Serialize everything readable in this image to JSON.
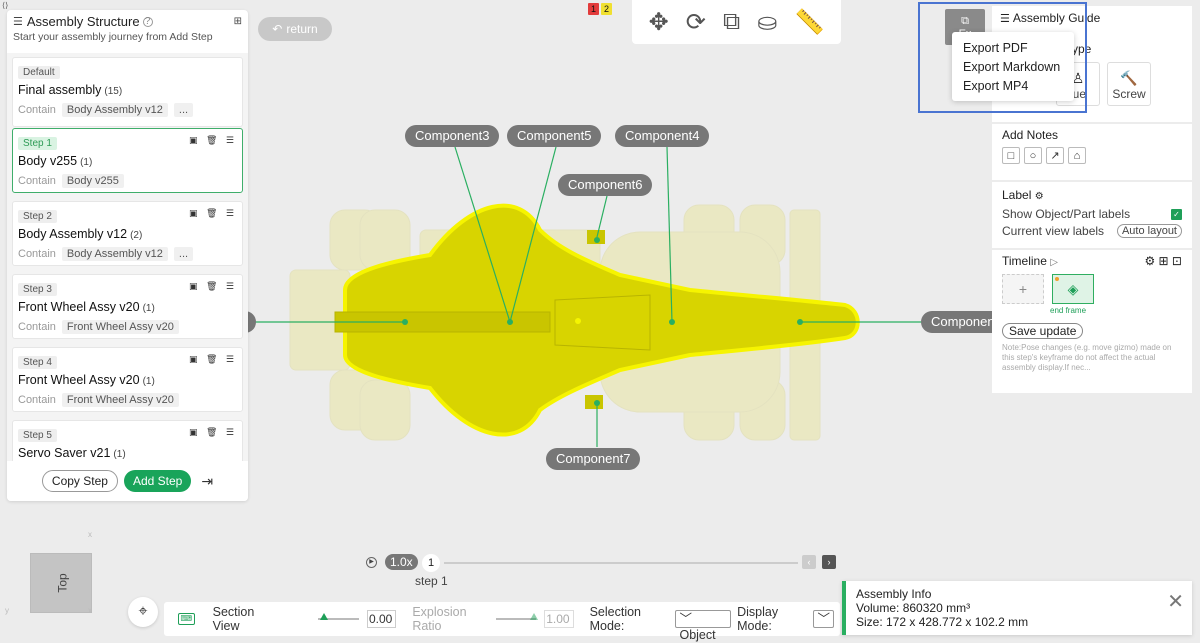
{
  "corner_glyph": "⟨⟩",
  "left_panel": {
    "title": "Assembly Structure",
    "subtitle": "Start your assembly journey from Add Step",
    "help_glyph": "?",
    "list_glyph": "☰",
    "grid_glyph": "⊞",
    "steps": [
      {
        "tag": "Default",
        "name": "Final assembly",
        "count": "(15)",
        "contain_label": "Contain",
        "chips": [
          "Body Assembly v12",
          "..."
        ],
        "actions": ""
      },
      {
        "tag": "Step 1",
        "name": "Body v255",
        "count": "(1)",
        "contain_label": "Contain",
        "chips": [
          "Body v255"
        ],
        "actions": "▣ 🗑 ☰"
      },
      {
        "tag": "Step 2",
        "name": "Body Assembly v12",
        "count": "(2)",
        "contain_label": "Contain",
        "chips": [
          "Body Assembly v12",
          "..."
        ],
        "actions": "▣ 🗑 ☰"
      },
      {
        "tag": "Step 3",
        "name": "Front Wheel Assy v20",
        "count": "(1)",
        "contain_label": "Contain",
        "chips": [
          "Front Wheel Assy v20"
        ],
        "actions": "▣ 🗑 ☰"
      },
      {
        "tag": "Step 4",
        "name": "Front Wheel Assy v20",
        "count": "(1)",
        "contain_label": "Contain",
        "chips": [
          "Front Wheel Assy v20"
        ],
        "actions": "▣ 🗑 ☰"
      },
      {
        "tag": "Step 5",
        "name": "Servo Saver v21",
        "count": "(1)",
        "contain_label": "",
        "chips": [],
        "actions": "▣ 🗑 ☰"
      }
    ],
    "copy_step": "Copy Step",
    "add_step": "Add Step",
    "exit_glyph": "⇥"
  },
  "return_btn": {
    "glyph": "↶",
    "label": "return"
  },
  "counters": {
    "red": "1",
    "yellow": "2"
  },
  "toolbar": {
    "tools": [
      {
        "name": "move-gizmo-icon",
        "glyph": "✥"
      },
      {
        "name": "rotate-icon",
        "glyph": "⟳"
      },
      {
        "name": "explode-icon",
        "glyph": "⧉"
      },
      {
        "name": "paint-bucket-icon",
        "glyph": "⛀"
      },
      {
        "name": "ruler-icon",
        "glyph": "📏"
      }
    ]
  },
  "right_panel": {
    "export": {
      "glyph": "⧉",
      "label": "Ex"
    },
    "export_menu": [
      "Export PDF",
      "Export Markdown",
      "Export MP4"
    ],
    "guide_title": "Assembly Guide",
    "guide_glyph": "☰",
    "label_type": "ype",
    "type_buttons": [
      {
        "glyph": "♙",
        "label": "lue"
      },
      {
        "glyph": "🔨",
        "label": "Screw"
      }
    ],
    "notes_title": "Add Notes",
    "note_tools": [
      "□",
      "○",
      "↗",
      "⌂"
    ],
    "label_title": "Label",
    "label_glyph": "⚙",
    "show_labels": "Show Object/Part labels",
    "current_view_labels": "Current view labels",
    "auto_layout": "Auto layout",
    "timeline_title": "Timeline",
    "timeline_play_glyph": "▷",
    "timeline_tools_glyph": "⚙ ⊞ ⊡",
    "frame_add_glyph": "+",
    "end_frame_glyph": "◈",
    "end_frame": "end frame",
    "save_update": "Save update",
    "note": "Note:Pose changes (e.g. move gizmo) made on this step's keyframe do not affect the actual assembly display.If nec..."
  },
  "components": [
    "Component3",
    "Component5",
    "Component4",
    "Component6",
    "Component7",
    "Componen"
  ],
  "playback": {
    "play_glyph": "▶",
    "speed": "1.0x",
    "step_number": "1",
    "step_text": "step 1",
    "prev_glyph": "‹",
    "next_glyph": "›",
    "progress": 0
  },
  "view_cube": {
    "label": "Top",
    "axis_x": "x",
    "axis_y": "y",
    "axis_x2": "x"
  },
  "focus_glyph": "⌖",
  "bottom_bar": {
    "keyboard_glyph": "⌨",
    "section_view": "Section View",
    "section_value": "0.00",
    "explosion_ratio": "Explosion Ratio",
    "explosion_value": "1.00",
    "selection_mode": "Selection Mode:",
    "selection_value": "﹀ Object",
    "display_mode": "Display Mode:",
    "display_value": "﹀"
  },
  "info": {
    "title": "Assembly Info",
    "volume": "Volume: 860320 mm³",
    "size": "Size: 172 x 428.772 x 102.2 mm",
    "close_glyph": "✕"
  },
  "colors": {
    "accent": "#19a45a",
    "highlight": "#4a74d1",
    "part": "#d8d400"
  }
}
